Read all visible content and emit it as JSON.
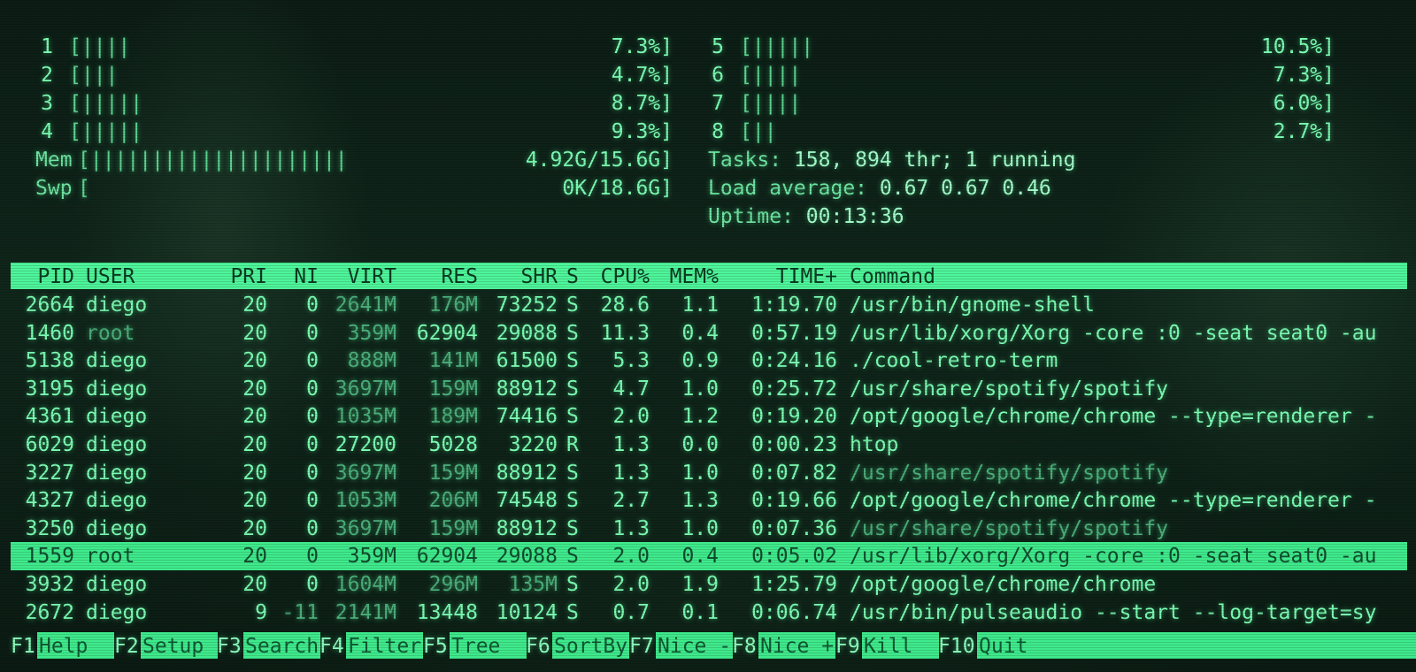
{
  "meters": {
    "cpus": [
      {
        "num": "1",
        "bar": "[||||",
        "value": "7.3%]"
      },
      {
        "num": "2",
        "bar": "[|||",
        "value": "4.7%]"
      },
      {
        "num": "3",
        "bar": "[|||||",
        "value": "8.7%]"
      },
      {
        "num": "4",
        "bar": "[|||||",
        "value": "9.3%]"
      },
      {
        "num": "5",
        "bar": "[|||||",
        "value": "10.5%]"
      },
      {
        "num": "6",
        "bar": "[||||",
        "value": "7.3%]"
      },
      {
        "num": "7",
        "bar": "[||||",
        "value": "6.0%]"
      },
      {
        "num": "8",
        "bar": "[||",
        "value": "2.7%]"
      }
    ],
    "mem": {
      "label": "Mem",
      "bar": "[|||||||||||||||||||||",
      "value": "4.92G/15.6G]"
    },
    "swp": {
      "label": "Swp",
      "bar": "[",
      "value": "0K/18.6G]"
    }
  },
  "stats": {
    "tasks_label": "Tasks: ",
    "tasks_value": "158, 894 thr; 1 running",
    "load_label": "Load average: ",
    "load_value": "0.67 0.67 0.46",
    "uptime_label": "Uptime: ",
    "uptime_value": "00:13:36"
  },
  "columns": {
    "pid": "PID",
    "user": "USER",
    "pri": "PRI",
    "ni": "NI",
    "virt": "VIRT",
    "res": "RES",
    "shr": "SHR",
    "s": "S",
    "cpu": "CPU%",
    "mem": "MEM%",
    "time": "TIME+",
    "cmd": "Command"
  },
  "processes": [
    {
      "pid": "2664",
      "user": "diego",
      "pri": "20",
      "ni": "0",
      "virt": "2641M",
      "res": "176M",
      "shr": "73252",
      "s": "S",
      "cpu": "28.6",
      "mem": "1.1",
      "time": "1:19.70",
      "cmd": "/usr/bin/gnome-shell"
    },
    {
      "pid": "1460",
      "user": "root",
      "pri": "20",
      "ni": "0",
      "virt": "359M",
      "res": "62904",
      "shr": "29088",
      "s": "S",
      "cpu": "11.3",
      "mem": "0.4",
      "time": "0:57.19",
      "cmd": "/usr/lib/xorg/Xorg -core :0 -seat seat0 -au"
    },
    {
      "pid": "5138",
      "user": "diego",
      "pri": "20",
      "ni": "0",
      "virt": "888M",
      "res": "141M",
      "shr": "61500",
      "s": "S",
      "cpu": "5.3",
      "mem": "0.9",
      "time": "0:24.16",
      "cmd": "./cool-retro-term"
    },
    {
      "pid": "3195",
      "user": "diego",
      "pri": "20",
      "ni": "0",
      "virt": "3697M",
      "res": "159M",
      "shr": "88912",
      "s": "S",
      "cpu": "4.7",
      "mem": "1.0",
      "time": "0:25.72",
      "cmd": "/usr/share/spotify/spotify"
    },
    {
      "pid": "4361",
      "user": "diego",
      "pri": "20",
      "ni": "0",
      "virt": "1035M",
      "res": "189M",
      "shr": "74416",
      "s": "S",
      "cpu": "2.0",
      "mem": "1.2",
      "time": "0:19.20",
      "cmd": "/opt/google/chrome/chrome --type=renderer -"
    },
    {
      "pid": "6029",
      "user": "diego",
      "pri": "20",
      "ni": "0",
      "virt": "27200",
      "res": "5028",
      "shr": "3220",
      "s": "R",
      "cpu": "1.3",
      "mem": "0.0",
      "time": "0:00.23",
      "cmd": "htop"
    },
    {
      "pid": "3227",
      "user": "diego",
      "pri": "20",
      "ni": "0",
      "virt": "3697M",
      "res": "159M",
      "shr": "88912",
      "s": "S",
      "cpu": "1.3",
      "mem": "1.0",
      "time": "0:07.82",
      "cmd": "/usr/share/spotify/spotify"
    },
    {
      "pid": "4327",
      "user": "diego",
      "pri": "20",
      "ni": "0",
      "virt": "1053M",
      "res": "206M",
      "shr": "74548",
      "s": "S",
      "cpu": "2.7",
      "mem": "1.3",
      "time": "0:19.66",
      "cmd": "/opt/google/chrome/chrome --type=renderer -"
    },
    {
      "pid": "3250",
      "user": "diego",
      "pri": "20",
      "ni": "0",
      "virt": "3697M",
      "res": "159M",
      "shr": "88912",
      "s": "S",
      "cpu": "1.3",
      "mem": "1.0",
      "time": "0:07.36",
      "cmd": "/usr/share/spotify/spotify"
    },
    {
      "pid": "1559",
      "user": "root",
      "pri": "20",
      "ni": "0",
      "virt": "359M",
      "res": "62904",
      "shr": "29088",
      "s": "S",
      "cpu": "2.0",
      "mem": "0.4",
      "time": "0:05.02",
      "cmd": "/usr/lib/xorg/Xorg -core :0 -seat seat0 -au"
    },
    {
      "pid": "3932",
      "user": "diego",
      "pri": "20",
      "ni": "0",
      "virt": "1604M",
      "res": "296M",
      "shr": "135M",
      "s": "S",
      "cpu": "2.0",
      "mem": "1.9",
      "time": "1:25.79",
      "cmd": "/opt/google/chrome/chrome"
    },
    {
      "pid": "2672",
      "user": "diego",
      "pri": "9",
      "ni": "-11",
      "virt": "2141M",
      "res": "13448",
      "shr": "10124",
      "s": "S",
      "cpu": "0.7",
      "mem": "0.1",
      "time": "0:06.74",
      "cmd": "/usr/bin/pulseaudio --start --log-target=sy"
    }
  ],
  "selected_row": 9,
  "function_keys": [
    {
      "key": "F1",
      "label": "Help"
    },
    {
      "key": "F2",
      "label": "Setup"
    },
    {
      "key": "F3",
      "label": "Search"
    },
    {
      "key": "F4",
      "label": "Filter"
    },
    {
      "key": "F5",
      "label": "Tree"
    },
    {
      "key": "F6",
      "label": "SortBy"
    },
    {
      "key": "F7",
      "label": "Nice -"
    },
    {
      "key": "F8",
      "label": "Nice +"
    },
    {
      "key": "F9",
      "label": "Kill"
    },
    {
      "key": "F10",
      "label": "Quit"
    }
  ],
  "colors": {
    "phosphor": "#7dffb4",
    "highlight": "#3fea8c",
    "header": "#4ef59a",
    "background": "#0a1a12"
  }
}
